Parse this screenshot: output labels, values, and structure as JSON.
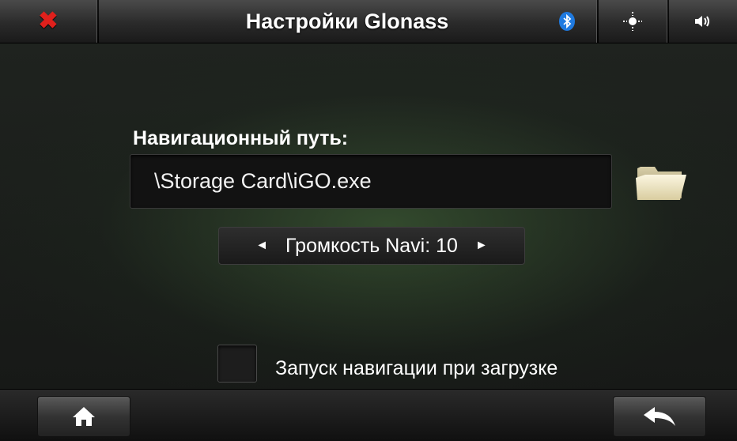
{
  "header": {
    "title": "Настройки Glonass",
    "close_icon": "close-x-icon",
    "bluetooth_icon": "bluetooth-icon",
    "bluetooth_glyph": "ʙ",
    "brightness_icon": "brightness-icon",
    "brightness_glyph": "☀",
    "volume_icon": "speaker-icon",
    "volume_glyph": "◀)",
    "close_color": "#e0201c",
    "bluetooth_color": "#1f7ae0"
  },
  "main": {
    "nav_path_label": "Навигационный путь:",
    "nav_path_value": "\\Storage Card\\iGO.exe",
    "browse_icon": "folder-icon",
    "volume_label": "Громкость Navi: 10",
    "volume_prev_glyph": "◄",
    "volume_next_glyph": "►",
    "autostart_label": "Запуск навигации при загрузке",
    "autostart_checked": false
  },
  "footer": {
    "home_icon": "home-icon",
    "back_icon": "back-arrow-icon"
  }
}
